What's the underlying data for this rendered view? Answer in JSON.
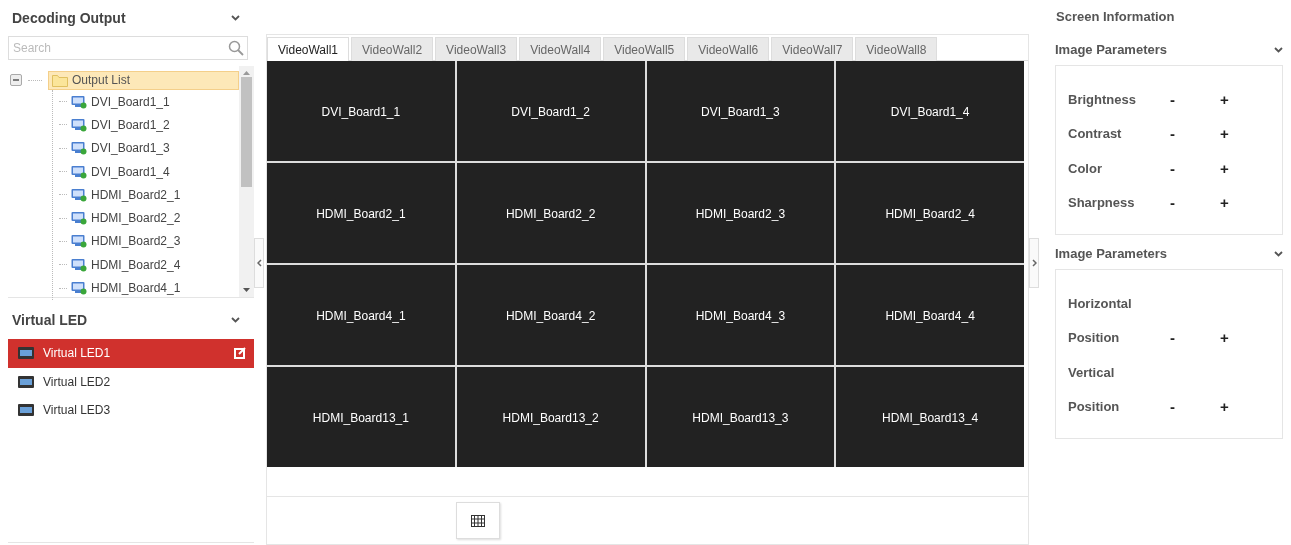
{
  "decoding_output": {
    "title": "Decoding Output",
    "search": {
      "placeholder": "Search"
    },
    "tree": {
      "label": "Output List",
      "expanded": true,
      "selected": true,
      "children": [
        {
          "label": "DVI_Board1_1",
          "selected": false
        },
        {
          "label": "DVI_Board1_2",
          "selected": false
        },
        {
          "label": "DVI_Board1_3",
          "selected": false
        },
        {
          "label": "DVI_Board1_4",
          "selected": false
        },
        {
          "label": "HDMI_Board2_1",
          "selected": false
        },
        {
          "label": "HDMI_Board2_2",
          "selected": false
        },
        {
          "label": "HDMI_Board2_3",
          "selected": false
        },
        {
          "label": "HDMI_Board2_4",
          "selected": false
        },
        {
          "label": "HDMI_Board4_1",
          "selected": false
        }
      ]
    }
  },
  "virtual_led": {
    "title": "Virtual LED",
    "items": [
      {
        "label": "Virtual LED1",
        "selected": true
      },
      {
        "label": "Virtual LED2",
        "selected": false
      },
      {
        "label": "Virtual LED3",
        "selected": false
      }
    ]
  },
  "tabs": [
    {
      "label": "VideoWall1",
      "selected": true
    },
    {
      "label": "VideoWall2",
      "selected": false
    },
    {
      "label": "VideoWall3",
      "selected": false
    },
    {
      "label": "VideoWall4",
      "selected": false
    },
    {
      "label": "VideoWall5",
      "selected": false
    },
    {
      "label": "VideoWall6",
      "selected": false
    },
    {
      "label": "VideoWall7",
      "selected": false
    },
    {
      "label": "VideoWall8",
      "selected": false
    }
  ],
  "wall_cells": [
    "DVI_Board1_1",
    "DVI_Board1_2",
    "DVI_Board1_3",
    "DVI_Board1_4",
    "HDMI_Board2_1",
    "HDMI_Board2_2",
    "HDMI_Board2_3",
    "HDMI_Board2_4",
    "HDMI_Board4_1",
    "HDMI_Board4_2",
    "HDMI_Board4_3",
    "HDMI_Board4_4",
    "HDMI_Board13_1",
    "HDMI_Board13_2",
    "HDMI_Board13_3",
    "HDMI_Board13_4"
  ],
  "screen_information": {
    "title": "Screen Information",
    "sections": [
      {
        "title": "Image Parameters",
        "rows": [
          {
            "kind": "adjust",
            "label": "Brightness",
            "minus": "-",
            "plus": "+"
          },
          {
            "kind": "adjust",
            "label": "Contrast",
            "minus": "-",
            "plus": "+"
          },
          {
            "kind": "adjust",
            "label": "Color",
            "minus": "-",
            "plus": "+"
          },
          {
            "kind": "adjust",
            "label": "Sharpness",
            "minus": "-",
            "plus": "+"
          }
        ]
      },
      {
        "title": "Image Parameters",
        "rows": [
          {
            "kind": "label",
            "label": "Horizontal"
          },
          {
            "kind": "adjust",
            "label": "Position",
            "minus": "-",
            "plus": "+"
          },
          {
            "kind": "label",
            "label": "Vertical"
          },
          {
            "kind": "adjust",
            "label": "Position",
            "minus": "-",
            "plus": "+"
          }
        ]
      }
    ]
  }
}
